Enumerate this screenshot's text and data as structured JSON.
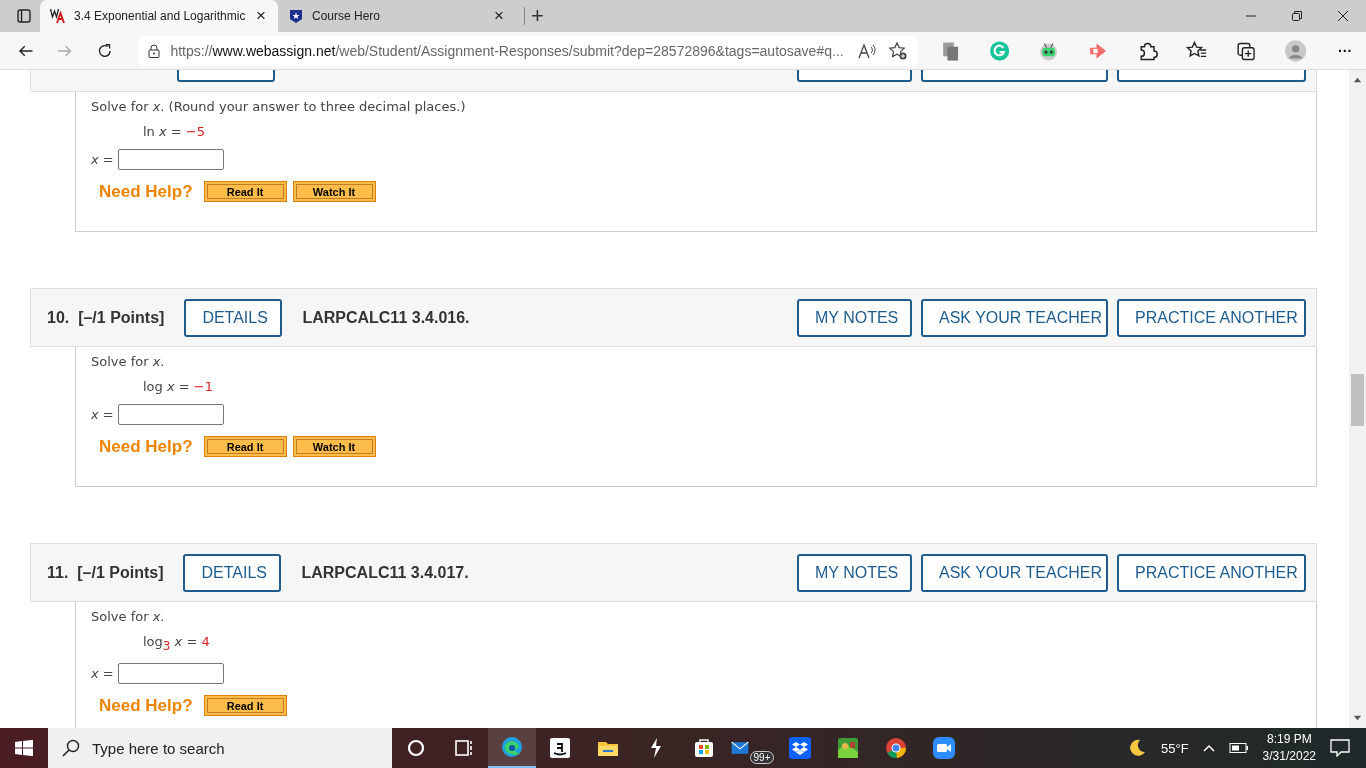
{
  "browser": {
    "tabs": [
      {
        "title": "3.4 Exponential and Logarithmic",
        "selected": true,
        "close": "×"
      },
      {
        "title": "Course Hero",
        "selected": false,
        "close": "×"
      }
    ],
    "new_tab": "+",
    "url": {
      "prefix": "https://",
      "host": "www.webassign.net",
      "rest": "/web/Student/Assignment-Responses/submit?dep=28572896&tags=autosave#q..."
    },
    "more": "···"
  },
  "questions": [
    {
      "header_cut": true,
      "prompt": "Solve for *x*. (Round your answer to three decimal places.)",
      "equation": [
        {
          "kind": "text",
          "text": "ln *x* = "
        },
        {
          "kind": "given",
          "text": "−5"
        }
      ],
      "answer_label": "*x* =",
      "help_label": "Need Help?",
      "help_buttons": [
        "Read It",
        "Watch It"
      ]
    },
    {
      "header_cut": false,
      "number": "10.",
      "points": "[–/1 Points]",
      "details": "DETAILS",
      "code": "LARPCALC11 3.4.016.",
      "actions": [
        "MY NOTES",
        "ASK YOUR TEACHER",
        "PRACTICE ANOTHER"
      ],
      "prompt": "Solve for *x*.",
      "equation": [
        {
          "kind": "text",
          "text": "log *x* = "
        },
        {
          "kind": "given",
          "text": "−1"
        }
      ],
      "answer_label": "*x* =",
      "help_label": "Need Help?",
      "help_buttons": [
        "Read It",
        "Watch It"
      ]
    },
    {
      "header_cut": false,
      "number": "11.",
      "points": "[–/1 Points]",
      "details": "DETAILS",
      "code": "LARPCALC11 3.4.017.",
      "actions": [
        "MY NOTES",
        "ASK YOUR TEACHER",
        "PRACTICE ANOTHER"
      ],
      "prompt": "Solve for *x*.",
      "equation": [
        {
          "kind": "text",
          "text": "log"
        },
        {
          "kind": "given_sub",
          "text": "3"
        },
        {
          "kind": "text",
          "text": " *x* = "
        },
        {
          "kind": "given",
          "text": "4"
        }
      ],
      "answer_label": "*x* =",
      "help_label": "Need Help?",
      "help_buttons": [
        "Read It"
      ]
    }
  ],
  "taskbar": {
    "search_placeholder": "Type here to search",
    "mail_badge": "99+",
    "weather": "55°F",
    "time": "8:19 PM",
    "date": "3/31/2022"
  }
}
